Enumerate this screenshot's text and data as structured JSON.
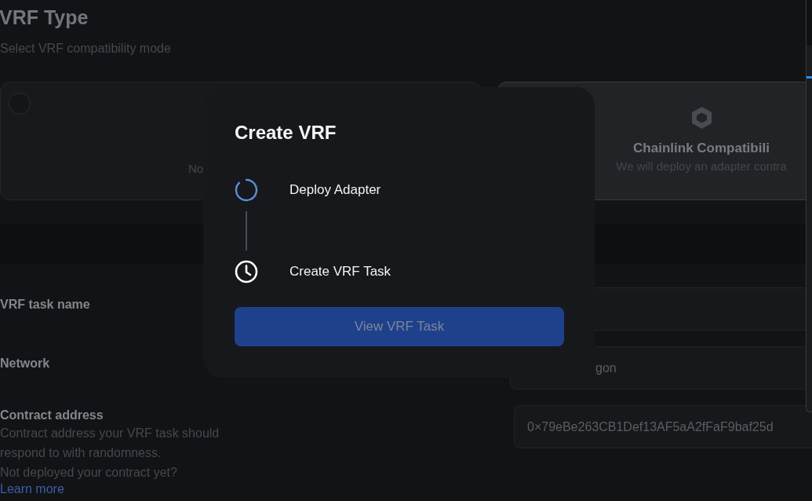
{
  "page": {
    "title": "VRF Type",
    "subtitle": "Select VRF compatibility mode"
  },
  "type_cards": [
    {
      "kind": "radio",
      "description": "No",
      "selected": false
    },
    {
      "kind": "chainlink",
      "title": "Chainlink Compatibili",
      "description": "We will deploy an adapter contra",
      "selected": true
    }
  ],
  "form": [
    {
      "label": "VRF task name"
    },
    {
      "label": "Network",
      "value": "gon"
    },
    {
      "label": "Contract address",
      "help": "Contract address your VRF task should respond to with randomness.",
      "note": "Not deployed your contract yet?",
      "link": "Learn more",
      "value": "0×79eBe263CB1Def13AF5aA2fFaF9baf25d"
    }
  ],
  "modal": {
    "title": "Create VRF",
    "steps": [
      {
        "label": "Deploy Adapter",
        "active": true
      },
      {
        "label": "Create VRF Task",
        "active": false
      }
    ],
    "button": {
      "label": "View VRF Task",
      "disabled": true
    }
  }
}
